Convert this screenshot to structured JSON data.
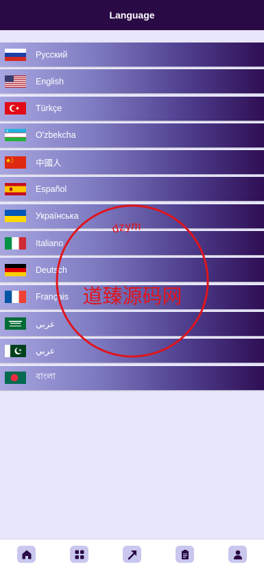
{
  "header": {
    "title": "Language"
  },
  "languages": [
    {
      "label": "Русский",
      "flag": "russia-flag-icon"
    },
    {
      "label": "English",
      "flag": "usa-flag-icon"
    },
    {
      "label": "Türkçe",
      "flag": "turkey-flag-icon"
    },
    {
      "label": "O'zbekcha",
      "flag": "uzbekistan-flag-icon"
    },
    {
      "label": "中國人",
      "flag": "china-flag-icon"
    },
    {
      "label": "Español",
      "flag": "spain-flag-icon"
    },
    {
      "label": "Українська",
      "flag": "ukraine-flag-icon"
    },
    {
      "label": "Italiano",
      "flag": "italy-flag-icon"
    },
    {
      "label": "Deutsch",
      "flag": "germany-flag-icon"
    },
    {
      "label": "Français",
      "flag": "france-flag-icon"
    },
    {
      "label": "عربي",
      "flag": "saudi-arabia-flag-icon"
    },
    {
      "label": "عربي",
      "flag": "pakistan-flag-icon"
    },
    {
      "label": "বাংলা",
      "flag": "bangladesh-flag-icon"
    }
  ],
  "watermark": {
    "center_text": "道臻源码网",
    "top_text": "dzym",
    "color": "#e0141c"
  },
  "bottom_nav": [
    "home-icon",
    "grid-icon",
    "arrow-up-right-icon",
    "clipboard-icon",
    "user-icon"
  ],
  "colors": {
    "header_bg": "#2a0a45",
    "page_bg": "#e8e6fb",
    "row_gradient_start": "#a8a6e0",
    "row_gradient_end": "#2f0f55",
    "nav_button_bg": "#c9c7ee"
  }
}
